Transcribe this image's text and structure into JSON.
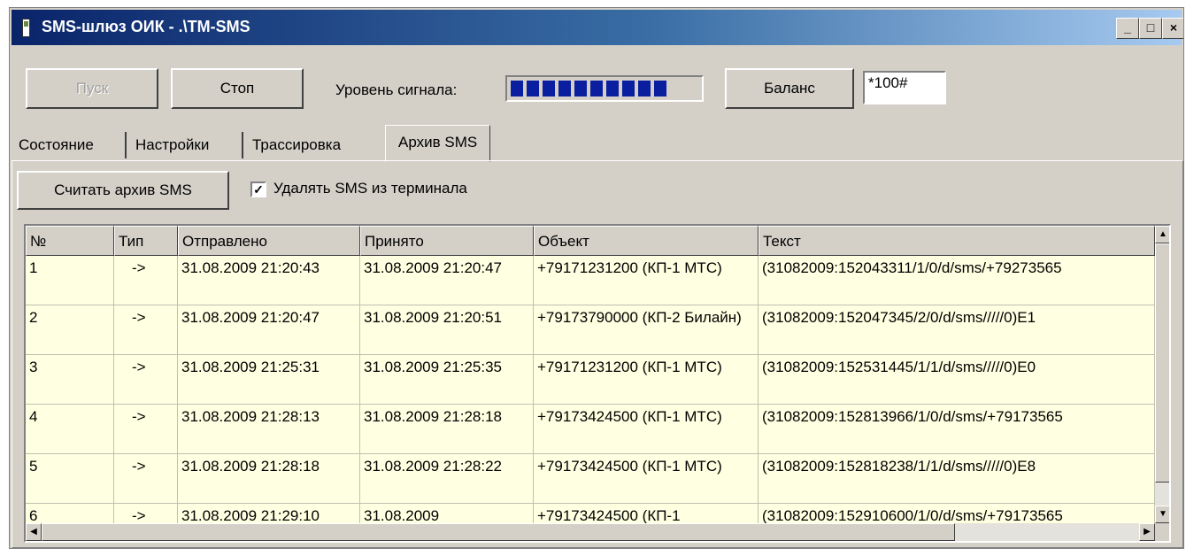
{
  "window": {
    "title": "SMS-шлюз ОИК - .\\TM-SMS",
    "minimize_icon": "minimize-icon",
    "maximize_icon": "maximize-icon",
    "close_icon": "close-icon"
  },
  "toolbar": {
    "start_label": "Пуск",
    "stop_label": "Стоп",
    "signal_label": "Уровень сигнала:",
    "signal_level_fraction": 0.8,
    "balance_label": "Баланс",
    "ussd_value": "*100#"
  },
  "tabs": [
    {
      "label": "Состояние",
      "active": false
    },
    {
      "label": "Настройки",
      "active": false
    },
    {
      "label": "Трассировка",
      "active": false
    },
    {
      "label": "Архив SMS",
      "active": true
    }
  ],
  "archive": {
    "read_button_label": "Считать архив SMS",
    "delete_checkbox_label": "Удалять SMS из терминала",
    "delete_checked": true
  },
  "table": {
    "columns": [
      "№",
      "Тип",
      "Отправлено",
      "Принято",
      "Объект",
      "Текст"
    ],
    "rows": [
      [
        "1",
        "->",
        "31.08.2009 21:20:43",
        "31.08.2009 21:20:47",
        "+79171231200 (КП-1 МТС)",
        "(31082009:152043311/1/0/d/sms/+79273565"
      ],
      [
        "2",
        "->",
        "31.08.2009 21:20:47",
        "31.08.2009 21:20:51",
        "+79173790000 (КП-2 Билайн)",
        "(31082009:152047345/2/0/d/sms/////0)E1"
      ],
      [
        "3",
        "->",
        "31.08.2009 21:25:31",
        "31.08.2009 21:25:35",
        "+79171231200 (КП-1 МТС)",
        "(31082009:152531445/1/1/d/sms/////0)E0"
      ],
      [
        "4",
        "->",
        "31.08.2009 21:28:13",
        "31.08.2009 21:28:18",
        "+79173424500 (КП-1 МТС)",
        "(31082009:152813966/1/0/d/sms/+79173565"
      ],
      [
        "5",
        "->",
        "31.08.2009 21:28:18",
        "31.08.2009 21:28:22",
        "+79173424500 (КП-1 МТС)",
        "(31082009:152818238/1/1/d/sms/////0)E8"
      ],
      [
        "6",
        "->",
        "31.08.2009 21:29:10",
        "31.08.2009",
        "+79173424500 (КП-1",
        "(31082009:152910600/1/0/d/sms/+79173565"
      ]
    ],
    "scroll_up_icon": "arrow-up-icon",
    "scroll_down_icon": "arrow-down-icon",
    "scroll_left_icon": "arrow-left-icon",
    "scroll_right_icon": "arrow-right-icon"
  }
}
